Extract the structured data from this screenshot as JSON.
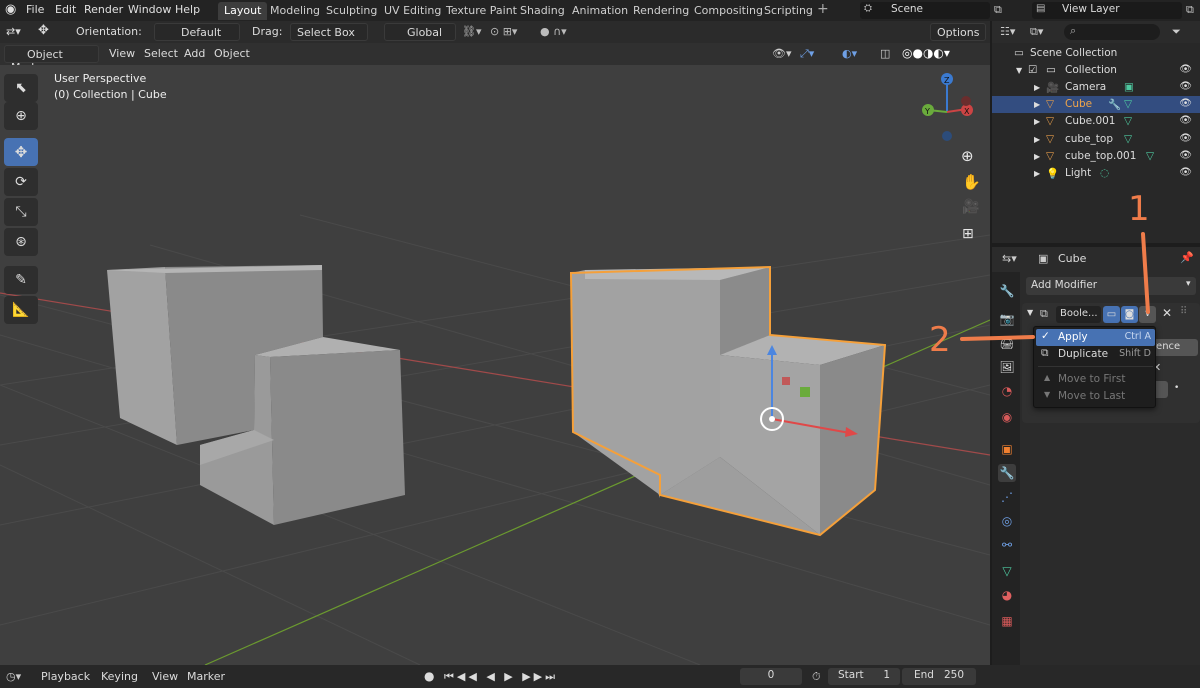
{
  "menubar": {
    "items": [
      "File",
      "Edit",
      "Render",
      "Window",
      "Help"
    ],
    "workspace_tabs": [
      "Layout",
      "Modeling",
      "Sculpting",
      "UV Editing",
      "Texture Paint",
      "Shading",
      "Animation",
      "Rendering",
      "Compositing",
      "Scripting"
    ],
    "active_tab": "Layout",
    "scene": "Scene",
    "view_layer": "View Layer"
  },
  "viewport_header": {
    "orientation_label": "Orientation:",
    "orientation_value": "Default",
    "drag_label": "Drag:",
    "drag_value": "Select Box",
    "transform_space": "Global",
    "options": "Options",
    "mode": "Object Mode",
    "menus": [
      "View",
      "Select",
      "Add",
      "Object"
    ]
  },
  "viewport": {
    "perspective": "User Perspective",
    "collection_info": "(0) Collection | Cube",
    "axis_x": "X",
    "axis_y": "Y",
    "axis_z": "Z"
  },
  "outliner": {
    "scene_collection": "Scene Collection",
    "collection": "Collection",
    "items": [
      "Camera",
      "Cube",
      "Cube.001",
      "cube_top",
      "cube_top.001",
      "Light"
    ],
    "selected": "Cube"
  },
  "properties": {
    "object_name": "Cube",
    "add_modifier": "Add Modifier",
    "modifier_name": "Boole...",
    "partial_field": "erence"
  },
  "context_menu": {
    "items": [
      {
        "label": "Apply",
        "shortcut": "Ctrl A"
      },
      {
        "label": "Duplicate",
        "shortcut": "Shift D"
      },
      {
        "label": "Move to First",
        "shortcut": ""
      },
      {
        "label": "Move to Last",
        "shortcut": ""
      }
    ]
  },
  "annotations": {
    "one": "1",
    "two": "2"
  },
  "timeline": {
    "playback": "Playback",
    "keying": "Keying",
    "view": "View",
    "marker": "Marker",
    "current_frame": "0",
    "start_label": "Start",
    "start_value": "1",
    "end_label": "End",
    "end_value": "250"
  },
  "colors": {
    "accent": "#4772b3",
    "selection_outline": "#f5a03a",
    "annotation": "#ef7c4a"
  }
}
